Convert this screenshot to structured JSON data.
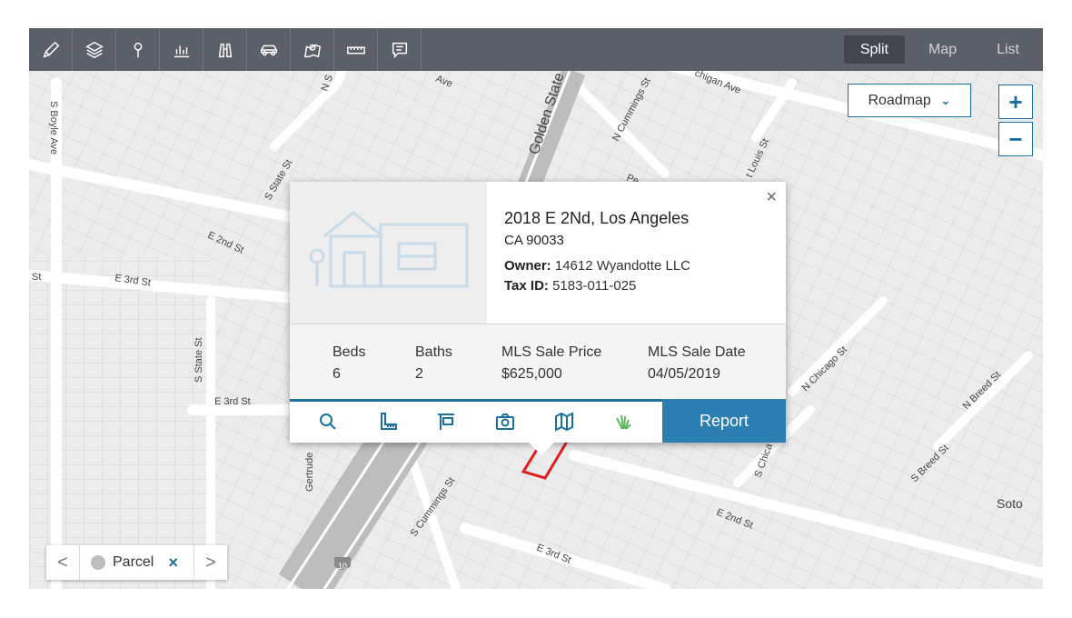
{
  "toolbar": {
    "tools": [
      "pencil-icon",
      "layers-icon",
      "pin-icon",
      "chart-icon",
      "binoculars-icon",
      "car-icon",
      "map-search-icon",
      "ruler-icon",
      "comment-icon"
    ],
    "views": [
      {
        "label": "Split",
        "active": true
      },
      {
        "label": "Map",
        "active": false
      },
      {
        "label": "List",
        "active": false
      }
    ]
  },
  "map_controls": {
    "layer_select": "Roadmap",
    "zoom_in": "+",
    "zoom_out": "−"
  },
  "street_labels": {
    "s_boyle": "S Boyle Ave",
    "n_s": "N S",
    "golden_state": "Golden State",
    "n_cummings": "N Cummings St",
    "michigan": "chigan Ave",
    "st_louis": "t Louis St",
    "s_state_top": "S State St",
    "e_2nd_left": "E 2nd St",
    "e_3rd_left": "E 3rd St",
    "st_edge": "St",
    "s_state_mid": "S State St",
    "e_3rd_mid": "E 3rd St",
    "gertrude": "Gertrude",
    "s_cummings": "S Cummings St",
    "n_chicago": "N Chicago St",
    "n_breed": "N Breed St",
    "s_chicago": "S Chica",
    "s_breed": "S Breed St",
    "e_2nd_right": "E 2nd St",
    "e_3rd_bottom": "E 3rd St",
    "soto": "Soto",
    "ave_top": "Ave",
    "pe": "Pe",
    "highway": "10"
  },
  "property": {
    "address_line1": "2018 E 2Nd, Los Angeles",
    "address_line2": "CA 90033",
    "owner_label": "Owner:",
    "owner_value": "14612 Wyandotte LLC",
    "tax_label": "Tax ID:",
    "tax_value": "5183-011-025",
    "close": "×",
    "stats": [
      {
        "label": "Beds",
        "value": "6"
      },
      {
        "label": "Baths",
        "value": "2"
      },
      {
        "label": "MLS Sale Price",
        "value": "$625,000"
      },
      {
        "label": "MLS Sale Date",
        "value": "04/05/2019"
      }
    ],
    "actions": [
      "search-icon",
      "measure-icon",
      "sign-icon",
      "camera-icon",
      "map-icon",
      "sunburst-icon"
    ],
    "report_label": "Report"
  },
  "filter": {
    "prev": "<",
    "label": "Parcel",
    "remove": "×",
    "next": ">"
  },
  "colors": {
    "toolbar": "#5b6068",
    "accent": "#1a6f9f",
    "report": "#2c7fb0",
    "parcel_outline": "#e02020"
  }
}
